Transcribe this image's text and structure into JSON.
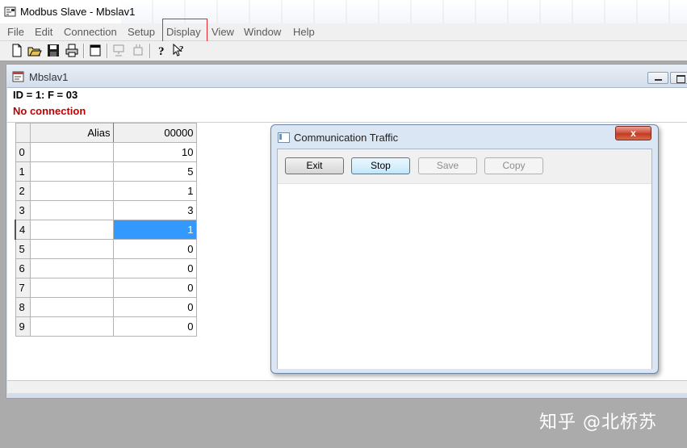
{
  "app": {
    "title": "Modbus Slave - Mbslav1"
  },
  "menu": {
    "items": [
      "File",
      "Edit",
      "Connection",
      "Setup",
      "Display",
      "View",
      "Window",
      "Help"
    ]
  },
  "toolbar": {
    "icons": [
      "new-file-icon",
      "open-folder-icon",
      "save-disk-icon",
      "print-icon",
      "window-icon",
      "connect-icon",
      "disconnect-icon",
      "help-icon",
      "context-help-icon"
    ]
  },
  "mdi": {
    "title": "Mbslav1",
    "id_line": "ID = 1: F = 03",
    "status": "No connection",
    "grid": {
      "header_alias": "Alias",
      "header_value": "00000",
      "rows": [
        {
          "index": "0",
          "alias": "",
          "value": "10"
        },
        {
          "index": "1",
          "alias": "",
          "value": "5"
        },
        {
          "index": "2",
          "alias": "",
          "value": "1"
        },
        {
          "index": "3",
          "alias": "",
          "value": "3"
        },
        {
          "index": "4",
          "alias": "",
          "value": "1"
        },
        {
          "index": "5",
          "alias": "",
          "value": "0"
        },
        {
          "index": "6",
          "alias": "",
          "value": "0"
        },
        {
          "index": "7",
          "alias": "",
          "value": "0"
        },
        {
          "index": "8",
          "alias": "",
          "value": "0"
        },
        {
          "index": "9",
          "alias": "",
          "value": "0"
        }
      ],
      "selected_row": 4
    }
  },
  "dialog": {
    "title": "Communication Traffic",
    "close": "x",
    "buttons": {
      "exit": "Exit",
      "stop": "Stop",
      "save": "Save",
      "copy": "Copy"
    }
  },
  "watermark": "知乎 @北桥苏",
  "colors": {
    "status_red": "#c00000",
    "selection_blue": "#3399ff",
    "highlight_box": "#e3282e"
  }
}
